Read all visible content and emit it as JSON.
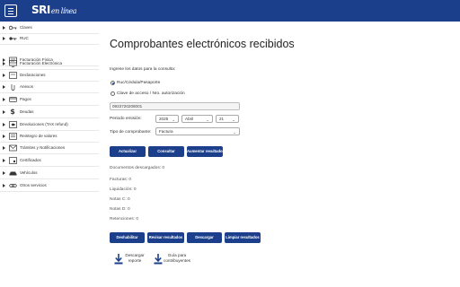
{
  "header": {
    "logo_main": "SRI",
    "logo_sub": "en línea"
  },
  "sidebar": {
    "items": [
      {
        "label": "Claves",
        "icon": "key-icon"
      },
      {
        "label": "RUC",
        "icon": "key-alt-icon"
      },
      {
        "label": "Facturación Física",
        "icon": "invoice-icon"
      },
      {
        "label": "Facturación Electrónica",
        "icon": "invoice-electronic-icon"
      },
      {
        "label": "Declaraciones",
        "icon": "document-icon"
      },
      {
        "label": "Anexos",
        "icon": "attachment-icon"
      },
      {
        "label": "Pagos",
        "icon": "payment-icon"
      },
      {
        "label": "Deudas",
        "icon": "dollar-icon"
      },
      {
        "label": "Devoluciones (TAX refund)",
        "icon": "refund-icon"
      },
      {
        "label": "Reintegro de valores",
        "icon": "reimburse-icon"
      },
      {
        "label": "Trámites y Notificaciones",
        "icon": "procedures-icon"
      },
      {
        "label": "Certificados",
        "icon": "certificate-icon"
      },
      {
        "label": "Vehículos",
        "icon": "car-icon"
      },
      {
        "label": "Otros servicios",
        "icon": "link-icon"
      }
    ]
  },
  "main": {
    "title": "Comprobantes electrónicos recibidos",
    "instruction": "Ingrese los datos para la consulta:",
    "radio_ruc": "Ruc/Cédula/Pasaporte",
    "radio_clave": "Clave de acceso / Nro. autorización",
    "ruc_value": "0923720208001",
    "periodo_label": "Periodo emisión:",
    "year": "2025",
    "month": "Abril",
    "day": "21",
    "tipo_label": "Tipo de comprobante:",
    "tipo_value": "Factura",
    "buttons_top": [
      "Actualizar",
      "Consultar",
      "Aumentar resultados"
    ],
    "summary": [
      "Documentos descargados: 0",
      "Facturas: 0",
      "Liquidación: 0",
      "Notas C: 0",
      "Notas D: 0",
      "Retenciones: 0"
    ],
    "buttons_bottom": [
      "Deshabilitar",
      "Revisar resultados",
      "Descargar",
      "Limpiar resultados"
    ],
    "downloads": [
      {
        "label": "Descargar reporte",
        "icon": "download-icon"
      },
      {
        "label": "Guía para contribuyentes",
        "icon": "download-icon"
      }
    ]
  },
  "colors": {
    "brand": "#1b3f8b"
  }
}
